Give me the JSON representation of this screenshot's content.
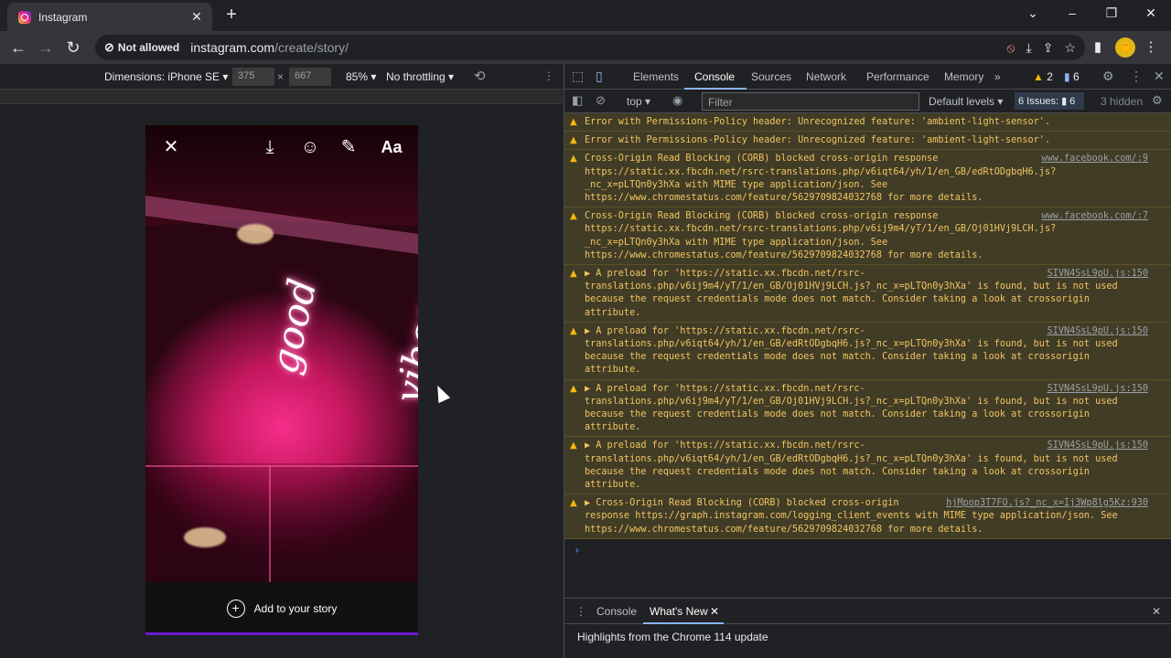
{
  "tab": {
    "title": "Instagram",
    "close": "✕"
  },
  "newtab": "+",
  "window": {
    "minimize": "–",
    "maximize": "❐",
    "close": "✕",
    "tabsearch": "⌄"
  },
  "nav": {
    "back": "←",
    "forward": "→",
    "reload": "↻"
  },
  "omnibox": {
    "site_badge": "Not allowed",
    "domain": "instagram.com",
    "path": "/create/story/"
  },
  "toolbar_icons": {
    "bookmark": "☆",
    "share": "⇪",
    "install": "⤓",
    "sidebar": "▮"
  },
  "avatar_letter": "🐥",
  "device": {
    "label": "Dimensions: iPhone SE ▾",
    "width": "375",
    "height": "667",
    "times": "×",
    "zoom": "85% ▾",
    "throttle": "No throttling ▾",
    "more": "⋮"
  },
  "story": {
    "neon_text": "good vibes",
    "add_label": "Add to your story",
    "plus": "+",
    "text_tool": "Aa"
  },
  "devtools": {
    "tabs": [
      "Elements",
      "Console",
      "Sources",
      "Network",
      "Performance",
      "Memory"
    ],
    "more_tabs": "»",
    "warn_count": "2",
    "info_count": "6",
    "top_context": "top ▾",
    "filter_placeholder": "Filter",
    "levels": "Default levels ▾",
    "issues": "6 Issues: ▮ 6",
    "hidden": "3 hidden",
    "messages": [
      {
        "text": "Error with Permissions-Policy header: Unrecognized feature: 'ambient-light-sensor'.",
        "src": ""
      },
      {
        "text": "Error with Permissions-Policy header: Unrecognized feature: 'ambient-light-sensor'.",
        "src": ""
      },
      {
        "text": "Cross-Origin Read Blocking (CORB) blocked cross-origin response https://static.xx.fbcdn.net/rsrc-translations.php/v6iqt64/yh/1/en_GB/edRtODgbqH6.js?_nc_x=pLTQn0y3hXa with MIME type application/json. See https://www.chromestatus.com/feature/5629709824032768 for more details.",
        "src": "www.facebook.com/:9"
      },
      {
        "text": "Cross-Origin Read Blocking (CORB) blocked cross-origin response https://static.xx.fbcdn.net/rsrc-translations.php/v6ij9m4/yT/1/en_GB/Oj01HVj9LCH.js?_nc_x=pLTQn0y3hXa with MIME type application/json. See https://www.chromestatus.com/feature/5629709824032768 for more details.",
        "src": "www.facebook.com/:7"
      },
      {
        "text": "▶ A preload for 'https://static.xx.fbcdn.net/rsrc-translations.php/v6ij9m4/yT/1/en_GB/Oj01HVj9LCH.js?_nc_x=pLTQn0y3hXa' is found, but is not used because the request credentials mode does not match. Consider taking a look at crossorigin attribute.",
        "src": "SIVN4SsL9pU.js:150"
      },
      {
        "text": "▶ A preload for 'https://static.xx.fbcdn.net/rsrc-translations.php/v6iqt64/yh/1/en_GB/edRtODgbqH6.js?_nc_x=pLTQn0y3hXa' is found, but is not used because the request credentials mode does not match. Consider taking a look at crossorigin attribute.",
        "src": "SIVN4SsL9pU.js:150"
      },
      {
        "text": "▶ A preload for 'https://static.xx.fbcdn.net/rsrc-translations.php/v6ij9m4/yT/1/en_GB/Oj01HVj9LCH.js?_nc_x=pLTQn0y3hXa' is found, but is not used because the request credentials mode does not match. Consider taking a look at crossorigin attribute.",
        "src": "SIVN4SsL9pU.js:150"
      },
      {
        "text": "▶ A preload for 'https://static.xx.fbcdn.net/rsrc-translations.php/v6iqt64/yh/1/en_GB/edRtODgbqH6.js?_nc_x=pLTQn0y3hXa' is found, but is not used because the request credentials mode does not match. Consider taking a look at crossorigin attribute.",
        "src": "SIVN4SsL9pU.js:150"
      },
      {
        "text": "▶ Cross-Origin Read Blocking (CORB) blocked cross-origin response https://graph.instagram.com/logging_client_events with MIME type application/json. See https://www.chromestatus.com/feature/5629709824032768 for more details.",
        "src": "hjMpop3T7FO.js?_nc_x=Ij3Wp8lg5Kz:930"
      }
    ],
    "prompt": "›",
    "drawer": {
      "tabs": [
        "Console",
        "What's New"
      ],
      "close_tab": "✕",
      "close_drawer": "✕",
      "highlight": "Highlights from the Chrome 114 update"
    }
  },
  "colors": {
    "warning_bg": "#413c26",
    "warning_text": "#f2c562",
    "neon_pink": "#f62d8a",
    "devtools_bg": "#202124"
  }
}
